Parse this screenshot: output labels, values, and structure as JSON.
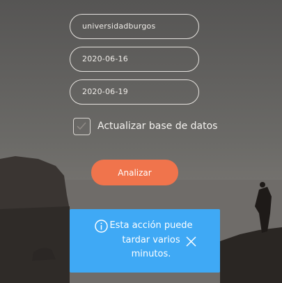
{
  "form": {
    "username_value": "universidadburgos",
    "start_date_value": "2020-06-16",
    "end_date_value": "2020-06-19",
    "update_db_checkbox": {
      "label": "Actualizar base de datos",
      "checked": false
    },
    "analyze_button_label": "Analizar"
  },
  "toast": {
    "message": "Esta acción puede tardar varios minutos.",
    "icon": "info-icon",
    "close_icon": "close-icon"
  },
  "colors": {
    "accent_button": "#f0744c",
    "toast_background": "#3fa9f5"
  }
}
